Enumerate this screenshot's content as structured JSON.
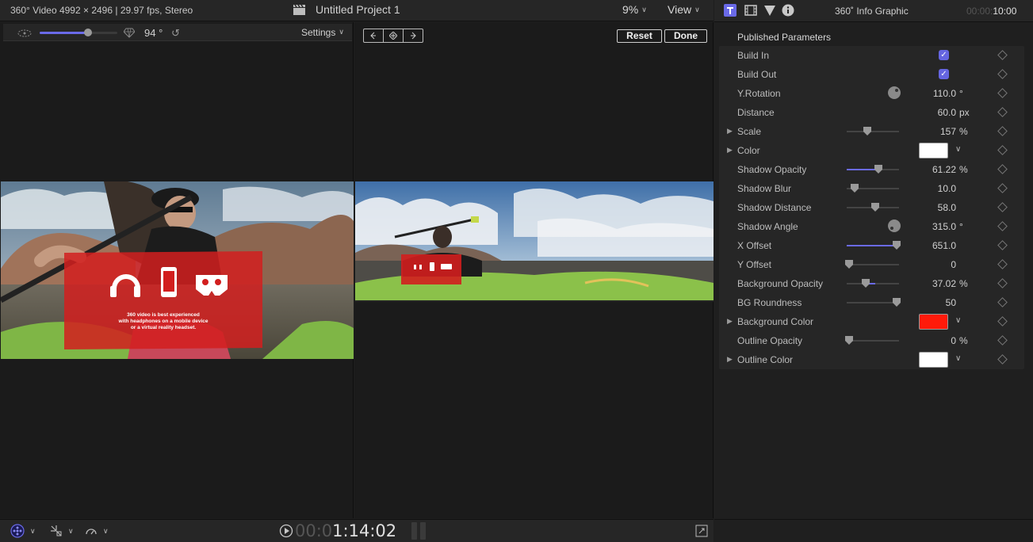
{
  "topbar": {
    "clip_info": "360° Video 4992 × 2496 | 29.97 fps, Stereo",
    "project_title": "Untitled Project 1",
    "zoom": "9%",
    "view_label": "View"
  },
  "left_viewer": {
    "fov_value": "94 °",
    "fov_fraction": 0.62,
    "settings_label": "Settings",
    "overlay_caption_lines": [
      "360 video is best experienced",
      "with headphones on a mobile device",
      "or a virtual reality headset."
    ]
  },
  "right_viewer": {
    "reset_label": "Reset",
    "done_label": "Done"
  },
  "inspector": {
    "title": "360˚ Info Graphic",
    "time_dim": "00:00:",
    "time_bright": "10:00",
    "section_header": "Published Parameters",
    "params": [
      {
        "label": "Build In",
        "control": "checkbox",
        "checked": true
      },
      {
        "label": "Build Out",
        "control": "checkbox",
        "checked": true
      },
      {
        "label": "Y.Rotation",
        "control": "dial",
        "value": "110.0",
        "unit": "°"
      },
      {
        "label": "Distance",
        "control": "none",
        "value": "60.0",
        "unit": "px"
      },
      {
        "label": "Scale",
        "control": "slider",
        "disclosure": true,
        "value": "157",
        "unit": "%",
        "level": 0.4
      },
      {
        "label": "Color",
        "control": "swatch",
        "disclosure": true,
        "color": "#ffffff"
      },
      {
        "label": "Shadow Opacity",
        "control": "slider",
        "value": "61.22",
        "unit": "%",
        "level": 0.6
      },
      {
        "label": "Shadow Blur",
        "control": "slider",
        "value": "10.0",
        "unit": "",
        "level": 0.15
      },
      {
        "label": "Shadow Distance",
        "control": "slider",
        "value": "58.0",
        "unit": "",
        "level": 0.55
      },
      {
        "label": "Shadow Angle",
        "control": "dial",
        "value": "315.0",
        "unit": "°"
      },
      {
        "label": "X Offset",
        "control": "slider",
        "value": "651.0",
        "unit": "",
        "level": 0.95
      },
      {
        "label": "Y Offset",
        "control": "slider",
        "value": "0",
        "unit": "",
        "level": 0.05
      },
      {
        "label": "Background Opacity",
        "control": "slider",
        "value": "37.02",
        "unit": "%",
        "level": 0.37
      },
      {
        "label": "BG Roundness",
        "control": "slider",
        "value": "50",
        "unit": "",
        "level": 0.95
      },
      {
        "label": "Background Color",
        "control": "swatch",
        "disclosure": true,
        "color": "#ff1a0a"
      },
      {
        "label": "Outline Opacity",
        "control": "slider",
        "value": "0",
        "unit": "%",
        "level": 0.05
      },
      {
        "label": "Outline Color",
        "control": "swatch",
        "disclosure": true,
        "color": "#ffffff"
      }
    ]
  },
  "bottombar": {
    "timecode_dim": "00:0",
    "timecode_bright": "1:14:02"
  },
  "colors": {
    "accent": "#6a6ae8",
    "overlay_red": "#d21e1e"
  }
}
